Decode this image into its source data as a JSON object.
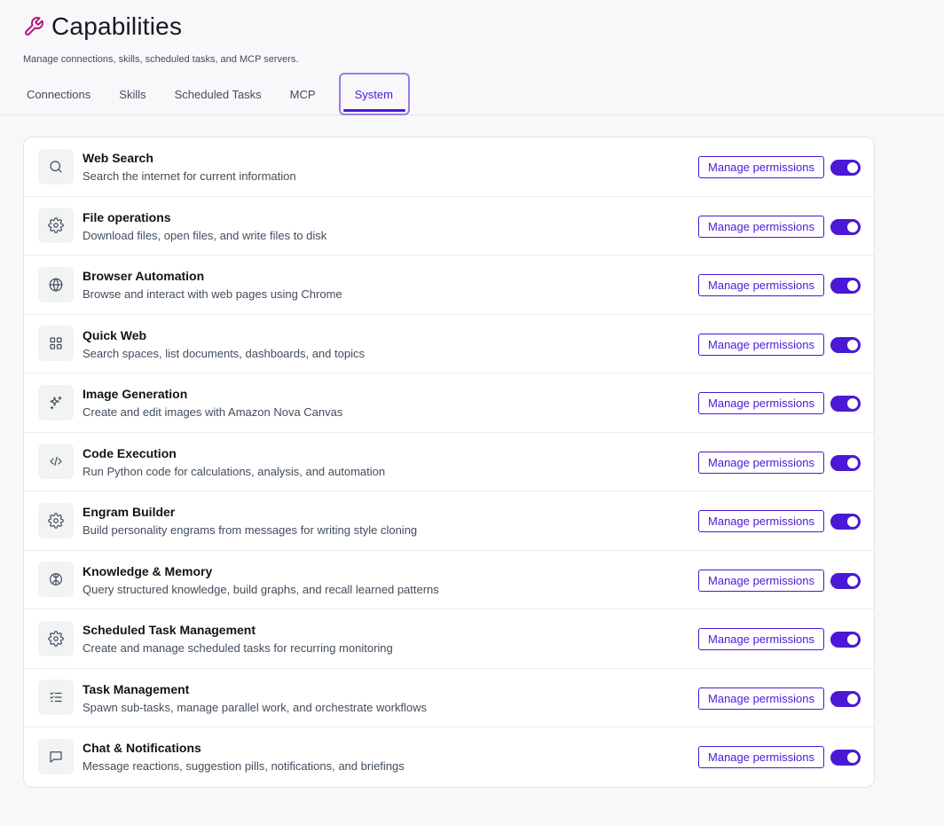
{
  "header": {
    "title": "Capabilities",
    "subtitle": "Manage connections, skills, scheduled tasks, and MCP servers."
  },
  "tabs": [
    {
      "label": "Connections"
    },
    {
      "label": "Skills"
    },
    {
      "label": "Scheduled Tasks"
    },
    {
      "label": "MCP"
    },
    {
      "label": "System",
      "active": true
    }
  ],
  "manage_label": "Manage permissions",
  "colors": {
    "accent": "#4b18d6",
    "icon_brand": "#b0157a"
  },
  "items": [
    {
      "name": "Web Search",
      "desc": "Search the internet for current information",
      "icon": "search-icon",
      "enabled": true
    },
    {
      "name": "File operations",
      "desc": "Download files, open files, and write files to disk",
      "icon": "gear-icon",
      "enabled": true
    },
    {
      "name": "Browser Automation",
      "desc": "Browse and interact with web pages using Chrome",
      "icon": "globe-icon",
      "enabled": true
    },
    {
      "name": "Quick Web",
      "desc": "Search spaces, list documents, dashboards, and topics",
      "icon": "grid-icon",
      "enabled": true
    },
    {
      "name": "Image Generation",
      "desc": "Create and edit images with Amazon Nova Canvas",
      "icon": "sparkle-icon",
      "enabled": true
    },
    {
      "name": "Code Execution",
      "desc": "Run Python code for calculations, analysis, and automation",
      "icon": "code-icon",
      "enabled": true
    },
    {
      "name": "Engram Builder",
      "desc": "Build personality engrams from messages for writing style cloning",
      "icon": "gear-icon",
      "enabled": true
    },
    {
      "name": "Knowledge & Memory",
      "desc": "Query structured knowledge, build graphs, and recall learned patterns",
      "icon": "brain-icon",
      "enabled": true
    },
    {
      "name": "Scheduled Task Management",
      "desc": "Create and manage scheduled tasks for recurring monitoring",
      "icon": "gear-icon",
      "enabled": true
    },
    {
      "name": "Task Management",
      "desc": "Spawn sub-tasks, manage parallel work, and orchestrate workflows",
      "icon": "checklist-icon",
      "enabled": true
    },
    {
      "name": "Chat & Notifications",
      "desc": "Message reactions, suggestion pills, notifications, and briefings",
      "icon": "chat-icon",
      "enabled": true
    }
  ]
}
